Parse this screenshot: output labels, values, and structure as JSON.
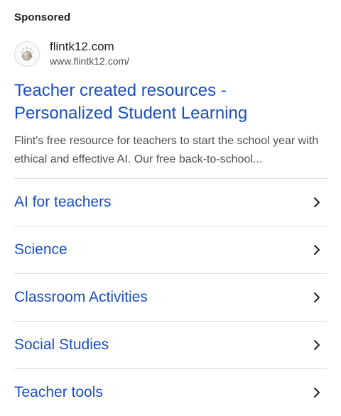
{
  "ad": {
    "sponsored_label": "Sponsored",
    "advertiser": {
      "name": "flintk12.com",
      "url": "www.flintk12.com/",
      "favicon_icon": "rock-logo-icon"
    },
    "headline_line1": "Teacher created resources -",
    "headline_line2": "Personalized Student Learning",
    "description": "Flint's free resource for teachers to start the school year with ethical and effective AI. Our free back-to-school...",
    "sitelinks": [
      {
        "label": "AI for teachers",
        "icon": "chevron-right-icon"
      },
      {
        "label": "Science",
        "icon": "chevron-right-icon"
      },
      {
        "label": "Classroom Activities",
        "icon": "chevron-right-icon"
      },
      {
        "label": "Social Studies",
        "icon": "chevron-right-icon"
      },
      {
        "label": "Teacher tools",
        "icon": "chevron-right-icon"
      }
    ]
  },
  "colors": {
    "link_blue": "#1a4fbf",
    "text_dark": "#202124",
    "text_gray": "#4d5156",
    "divider": "#dadce0"
  }
}
